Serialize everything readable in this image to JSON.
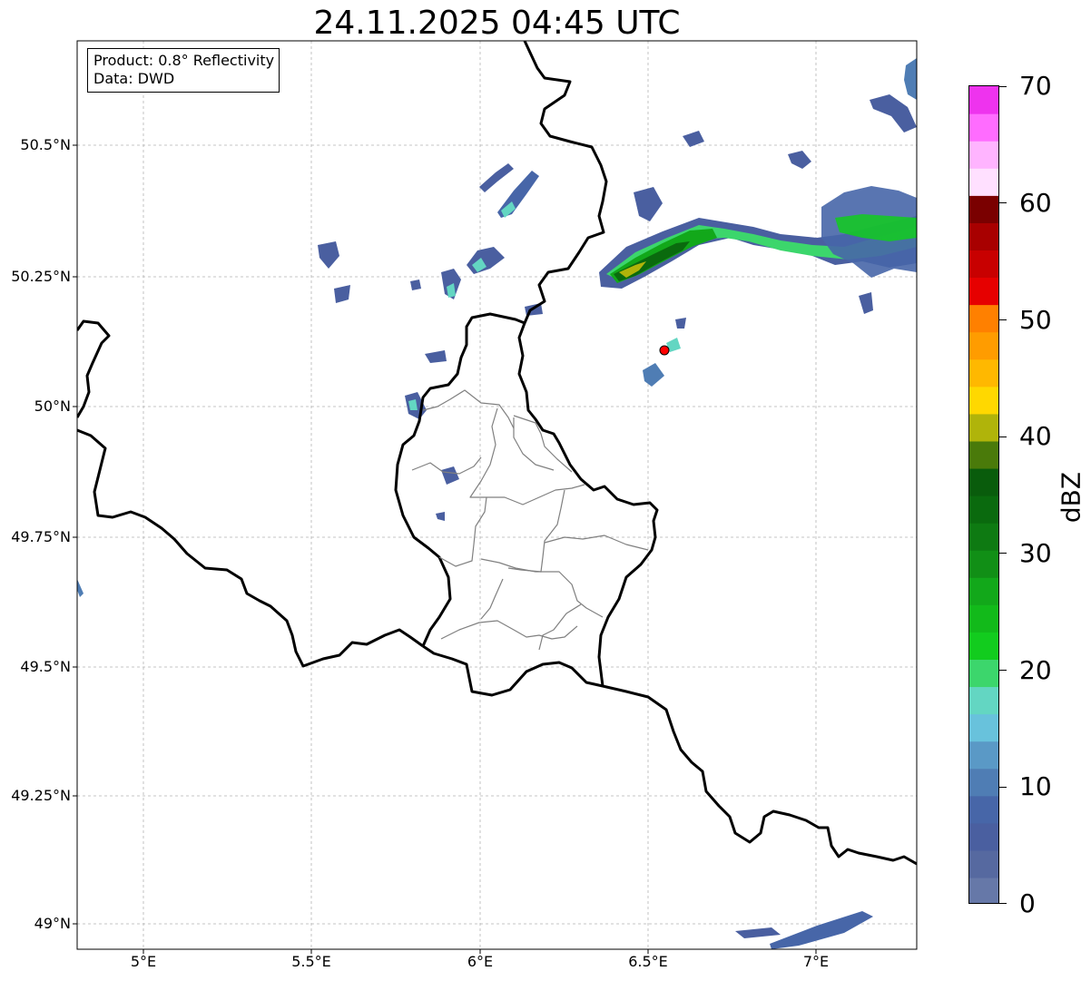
{
  "title": "24.11.2025 04:45 UTC",
  "info_box": {
    "product_line": "Product: 0.8° Reflectivity",
    "data_line": "Data: DWD"
  },
  "map": {
    "lon_range": [
      4.8,
      7.3
    ],
    "lat_range": [
      48.95,
      50.71
    ],
    "lat_ticks": [
      "50.5°N",
      "50.25°N",
      "50°N",
      "49.75°N",
      "49.5°N",
      "49.25°N",
      "49°N"
    ],
    "lon_ticks": [
      "5°E",
      "5.5°E",
      "6°E",
      "6.5°E",
      "7°E"
    ],
    "gridlines": true,
    "marker": {
      "lon": 6.55,
      "lat": 50.11,
      "color": "#ff0000"
    }
  },
  "colorbar": {
    "label": "dBZ",
    "min": 0,
    "max": 70,
    "tick_labels": [
      "0",
      "10",
      "20",
      "30",
      "40",
      "50",
      "60",
      "70"
    ],
    "colors": [
      "#6678a8",
      "#5669a0",
      "#4a5fa0",
      "#4766a8",
      "#4f7db4",
      "#5a99c6",
      "#68c2dc",
      "#63d6c2",
      "#3cd66c",
      "#12cc1e",
      "#12ba1a",
      "#12a81a",
      "#118f16",
      "#0e7a12",
      "#0a6a0e",
      "#095c0c",
      "#4a7a0a",
      "#b0b40a",
      "#ffd800",
      "#ffb800",
      "#ff9c00",
      "#ff8000",
      "#e60000",
      "#c80000",
      "#a80000",
      "#7a0000",
      "#ffe0ff",
      "#ffb4ff",
      "#ff6cff",
      "#ee33ee"
    ]
  }
}
